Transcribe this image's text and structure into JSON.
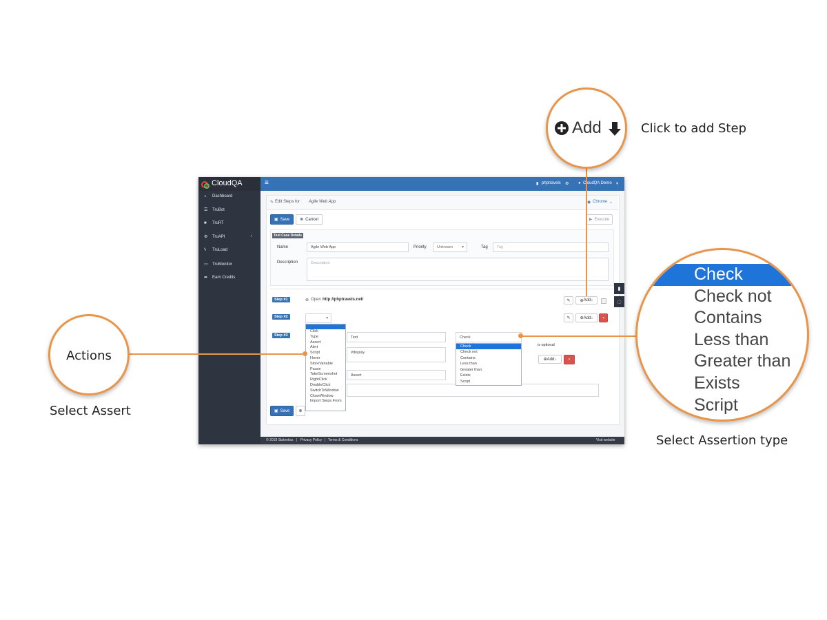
{
  "app": {
    "logo": "CloudQA",
    "topbar": {
      "menu_icon": "≡",
      "project": "phptravels",
      "user": "CloudQA Demo"
    },
    "sidebar": [
      {
        "icon": "dashboard-icon",
        "label": "Dashboard"
      },
      {
        "icon": "list-icon",
        "label": "TruBot"
      },
      {
        "icon": "briefcase-icon",
        "label": "TruRT"
      },
      {
        "icon": "cogs-icon",
        "label": "TruAPI"
      },
      {
        "icon": "bolt-icon",
        "label": "TruLoad"
      },
      {
        "icon": "monitor-icon",
        "label": "TruMonitor"
      },
      {
        "icon": "share-icon",
        "label": "Earn Credits"
      }
    ],
    "header": {
      "edit_label": "Edit Steps for",
      "app_name": "Agile Web App",
      "browser": "Chrome"
    },
    "toolbar": {
      "save": "Save",
      "cancel": "Cancel",
      "execute": "Execute"
    },
    "details": {
      "section_title": "Test Case Details",
      "name_label": "Name",
      "name_value": "Agile Web App",
      "priority_label": "Priority",
      "priority_value": "Unknown",
      "tag_label": "Tag",
      "tag_placeholder": "Tag",
      "description_label": "Description",
      "description_placeholder": "Description"
    },
    "steps": {
      "step1": {
        "badge": "Step #1",
        "text_prefix": "Open",
        "url": "http://phptravels.net/",
        "add": "Add"
      },
      "step2": {
        "badge": "Step #2",
        "add": "Add"
      },
      "step3": {
        "badge": "Step #3",
        "field1": "Text",
        "field2": "#display",
        "field3": "Assert",
        "check_value": "Check",
        "optional": "is optional",
        "add": "Add"
      }
    },
    "actions_menu": [
      "",
      "Click",
      "Type",
      "Assert",
      "Alert",
      "Script",
      "Hover",
      "StoreVariable",
      "Pause",
      "TakeScreenshot",
      "RightClick",
      "DoubleClick",
      "SwitchToWindow",
      "CloseWindow",
      "Import Steps From"
    ],
    "assert_menu": [
      "Check",
      "Check not",
      "Contains",
      "Less than",
      "Greater than",
      "Exists",
      "Script"
    ],
    "bottom_save": "Save",
    "footer": {
      "copyright": "© 2018 Statnetics",
      "privacy": "Privacy Policy",
      "terms": "Terms & Conditions",
      "visit": "Visit website"
    }
  },
  "annotations": {
    "add_zoom": "Add",
    "add_caption": "Click to add Step",
    "actions_circle": "Actions",
    "actions_caption": "Select Assert",
    "assert_zoom": [
      "Check",
      "Check not",
      "Contains",
      "Less than",
      "Greater than",
      "Exists",
      "Script"
    ],
    "assert_caption": "Select Assertion type"
  },
  "colors": {
    "accent": "#3673b6",
    "callout": "#e8954a",
    "selected": "#1e74d8",
    "danger": "#d9534f",
    "sidebar": "#2e3440"
  }
}
